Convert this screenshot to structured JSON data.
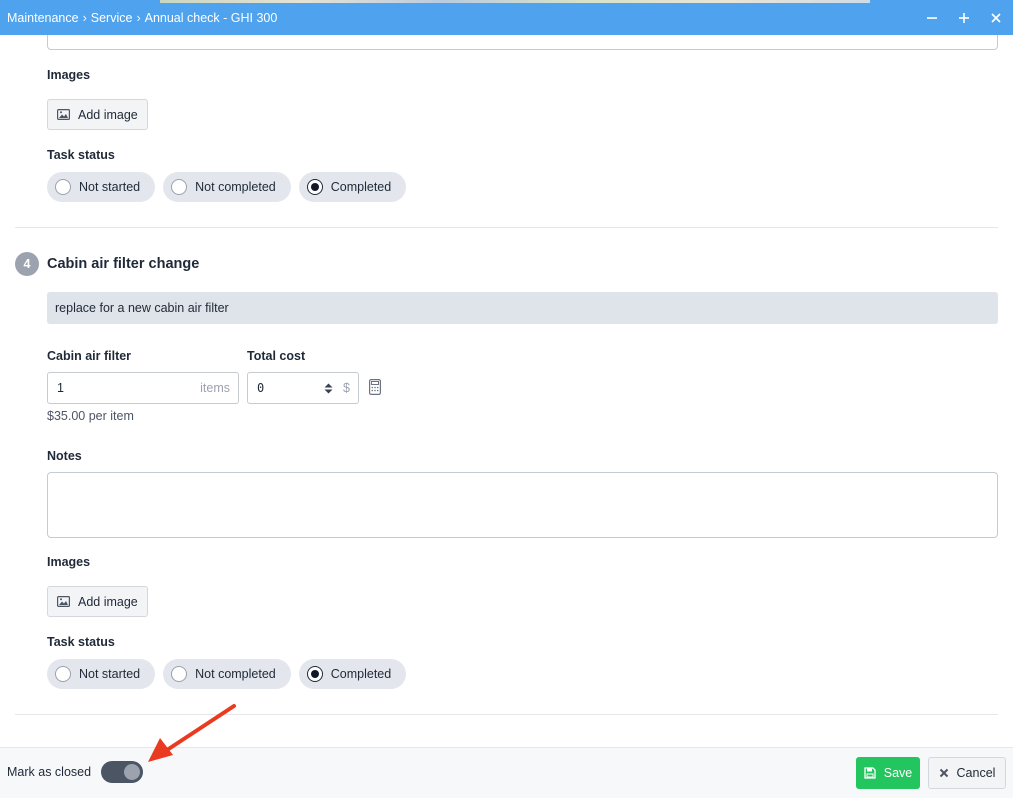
{
  "titlebar": {
    "breadcrumb": [
      "Maintenance",
      "Service",
      "Annual check - GHI 300"
    ],
    "separator": "›"
  },
  "previous_task": {
    "images_label": "Images",
    "add_image_label": "Add image",
    "status_label": "Task status",
    "status_options": [
      "Not started",
      "Not completed",
      "Completed"
    ],
    "selected_status": "Completed"
  },
  "task4": {
    "number": "4",
    "title": "Cabin air filter change",
    "description": "replace for a new cabin air filter",
    "part_label": "Cabin air filter",
    "quantity": "1",
    "quantity_unit": "items",
    "price_per_item": "$35.00 per item",
    "cost_label": "Total cost",
    "cost_value": "0",
    "cost_unit": "$",
    "notes_label": "Notes",
    "notes_value": "",
    "images_label": "Images",
    "add_image_label": "Add image",
    "status_label": "Task status",
    "status_options": [
      "Not started",
      "Not completed",
      "Completed"
    ],
    "selected_status": "Completed"
  },
  "footer": {
    "mark_closed_label": "Mark as closed",
    "mark_closed_on": true,
    "save_label": "Save",
    "cancel_label": "Cancel"
  },
  "colors": {
    "titlebar": "#4ea2ee",
    "save": "#22c55e",
    "annotation_arrow": "#ea3a1f"
  }
}
